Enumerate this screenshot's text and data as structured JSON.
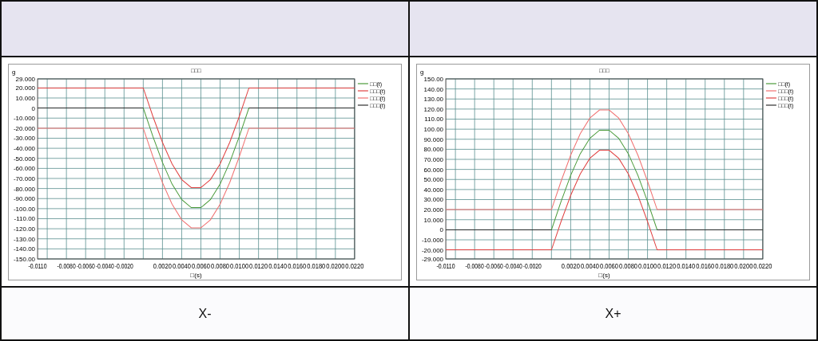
{
  "panels": [
    {
      "caption": "X-",
      "chart_data": {
        "type": "line",
        "grid": true,
        "legend": true,
        "title": "□□□",
        "ylabel": "g",
        "xlabel": "□(s)",
        "x": [
          -0.011,
          0,
          0.001,
          0.002,
          0.003,
          0.004,
          0.005,
          0.006,
          0.007,
          0.008,
          0.009,
          0.01,
          0.011,
          0.022
        ],
        "xlim": [
          -0.011,
          0.022
        ],
        "ylim": [
          -150,
          29
        ],
        "xticks": [
          {
            "value": -0.011,
            "label": "-0.0110"
          },
          {
            "value": -0.008,
            "label": "-0.0080"
          },
          {
            "value": -0.006,
            "label": "-0.0060"
          },
          {
            "value": -0.004,
            "label": "-0.0040"
          },
          {
            "value": -0.002,
            "label": "-0.0020"
          },
          {
            "value": 0.002,
            "label": "0.0020"
          },
          {
            "value": 0.004,
            "label": "0.0040"
          },
          {
            "value": 0.006,
            "label": "0.0060"
          },
          {
            "value": 0.008,
            "label": "0.0080"
          },
          {
            "value": 0.01,
            "label": "0.0100"
          },
          {
            "value": 0.012,
            "label": "0.0120"
          },
          {
            "value": 0.014,
            "label": "0.0140"
          },
          {
            "value": 0.016,
            "label": "0.0160"
          },
          {
            "value": 0.018,
            "label": "0.0180"
          },
          {
            "value": 0.02,
            "label": "0.0200"
          },
          {
            "value": 0.022,
            "label": "0.0220"
          }
        ],
        "yticks": [
          {
            "value": 29,
            "label": "29.000"
          },
          {
            "value": 20,
            "label": "20.000"
          },
          {
            "value": 10,
            "label": "10.000"
          },
          {
            "value": 0,
            "label": "0"
          },
          {
            "value": -10,
            "label": "-10.000"
          },
          {
            "value": -20,
            "label": "-20.000"
          },
          {
            "value": -30,
            "label": "-30.000"
          },
          {
            "value": -40,
            "label": "-40.000"
          },
          {
            "value": -50,
            "label": "-50.000"
          },
          {
            "value": -60,
            "label": "-60.000"
          },
          {
            "value": -70,
            "label": "-70.000"
          },
          {
            "value": -80,
            "label": "-80.000"
          },
          {
            "value": -90,
            "label": "-90.000"
          },
          {
            "value": -100,
            "label": "-100.00"
          },
          {
            "value": -110,
            "label": "-110.00"
          },
          {
            "value": -120,
            "label": "-120.00"
          },
          {
            "value": -130,
            "label": "-130.00"
          },
          {
            "value": -140,
            "label": "-140.00"
          },
          {
            "value": -150,
            "label": "-150.00"
          }
        ],
        "series": [
          {
            "name": "□□(t)",
            "color": "#4a9a3a",
            "values": [
              0,
              0,
              -28.2,
              -54.1,
              -75.6,
              -91,
              -99,
              -99,
              -91,
              -75.6,
              -54.1,
              -28.2,
              0,
              0
            ]
          },
          {
            "name": "□□□(t)",
            "color": "#e04040",
            "values": [
              20,
              20,
              -8.2,
              -34.1,
              -55.6,
              -71,
              -79,
              -79,
              -71,
              -55.6,
              -34.1,
              -8.2,
              20,
              20
            ]
          },
          {
            "name": "□□□(t)",
            "color": "#f07070",
            "values": [
              -20,
              -20,
              -48.2,
              -74.1,
              -95.6,
              -111,
              -119,
              -119,
              -111,
              -95.6,
              -74.1,
              -48.2,
              -20,
              -20
            ]
          },
          {
            "name": "□□□(t)",
            "color": "#303030",
            "values": [
              0,
              0,
              null,
              null,
              null,
              null,
              null,
              null,
              null,
              null,
              null,
              null,
              0,
              0
            ]
          }
        ]
      }
    },
    {
      "caption": "X+",
      "chart_data": {
        "type": "line",
        "grid": true,
        "legend": true,
        "title": "□□□",
        "ylabel": "g",
        "xlabel": "□(s)",
        "x": [
          -0.011,
          0,
          0.001,
          0.002,
          0.003,
          0.004,
          0.005,
          0.006,
          0.007,
          0.008,
          0.009,
          0.01,
          0.011,
          0.022
        ],
        "xlim": [
          -0.011,
          0.022
        ],
        "ylim": [
          -29,
          150
        ],
        "xticks": [
          {
            "value": -0.011,
            "label": "-0.0110"
          },
          {
            "value": -0.008,
            "label": "-0.0080"
          },
          {
            "value": -0.006,
            "label": "-0.0060"
          },
          {
            "value": -0.004,
            "label": "-0.0040"
          },
          {
            "value": -0.002,
            "label": "-0.0020"
          },
          {
            "value": 0.002,
            "label": "0.0020"
          },
          {
            "value": 0.004,
            "label": "0.0040"
          },
          {
            "value": 0.006,
            "label": "0.0060"
          },
          {
            "value": 0.008,
            "label": "0.0080"
          },
          {
            "value": 0.01,
            "label": "0.0100"
          },
          {
            "value": 0.012,
            "label": "0.0120"
          },
          {
            "value": 0.014,
            "label": "0.0140"
          },
          {
            "value": 0.016,
            "label": "0.0160"
          },
          {
            "value": 0.018,
            "label": "0.0180"
          },
          {
            "value": 0.02,
            "label": "0.0200"
          },
          {
            "value": 0.022,
            "label": "0.0220"
          }
        ],
        "yticks": [
          {
            "value": 150,
            "label": "150.00"
          },
          {
            "value": 140,
            "label": "140.00"
          },
          {
            "value": 130,
            "label": "130.00"
          },
          {
            "value": 120,
            "label": "120.00"
          },
          {
            "value": 110,
            "label": "110.00"
          },
          {
            "value": 100,
            "label": "100.00"
          },
          {
            "value": 90,
            "label": "90.000"
          },
          {
            "value": 80,
            "label": "80.000"
          },
          {
            "value": 70,
            "label": "70.000"
          },
          {
            "value": 60,
            "label": "60.000"
          },
          {
            "value": 50,
            "label": "50.000"
          },
          {
            "value": 40,
            "label": "40.000"
          },
          {
            "value": 30,
            "label": "30.000"
          },
          {
            "value": 20,
            "label": "20.000"
          },
          {
            "value": 10,
            "label": "10.000"
          },
          {
            "value": 0,
            "label": "0"
          },
          {
            "value": -10,
            "label": "-10.000"
          },
          {
            "value": -20,
            "label": "-20.000"
          },
          {
            "value": -29,
            "label": "-29.000"
          }
        ],
        "series": [
          {
            "name": "□□(t)",
            "color": "#4a9a3a",
            "values": [
              0,
              0,
              28.2,
              54.1,
              75.6,
              91,
              99,
              99,
              91,
              75.6,
              54.1,
              28.2,
              0,
              0
            ]
          },
          {
            "name": "□□□(t)",
            "color": "#f07070",
            "values": [
              20,
              20,
              48.2,
              74.1,
              95.6,
              111,
              119,
              119,
              111,
              95.6,
              74.1,
              48.2,
              20,
              20
            ]
          },
          {
            "name": "□□□(t)",
            "color": "#e04040",
            "values": [
              -20,
              -20,
              8.2,
              34.1,
              55.6,
              71,
              79,
              79,
              71,
              55.6,
              34.1,
              8.2,
              -20,
              -20
            ]
          },
          {
            "name": "□□□(t)",
            "color": "#303030",
            "values": [
              0,
              0,
              null,
              null,
              null,
              null,
              null,
              null,
              null,
              null,
              null,
              null,
              0,
              0
            ]
          }
        ]
      }
    }
  ]
}
